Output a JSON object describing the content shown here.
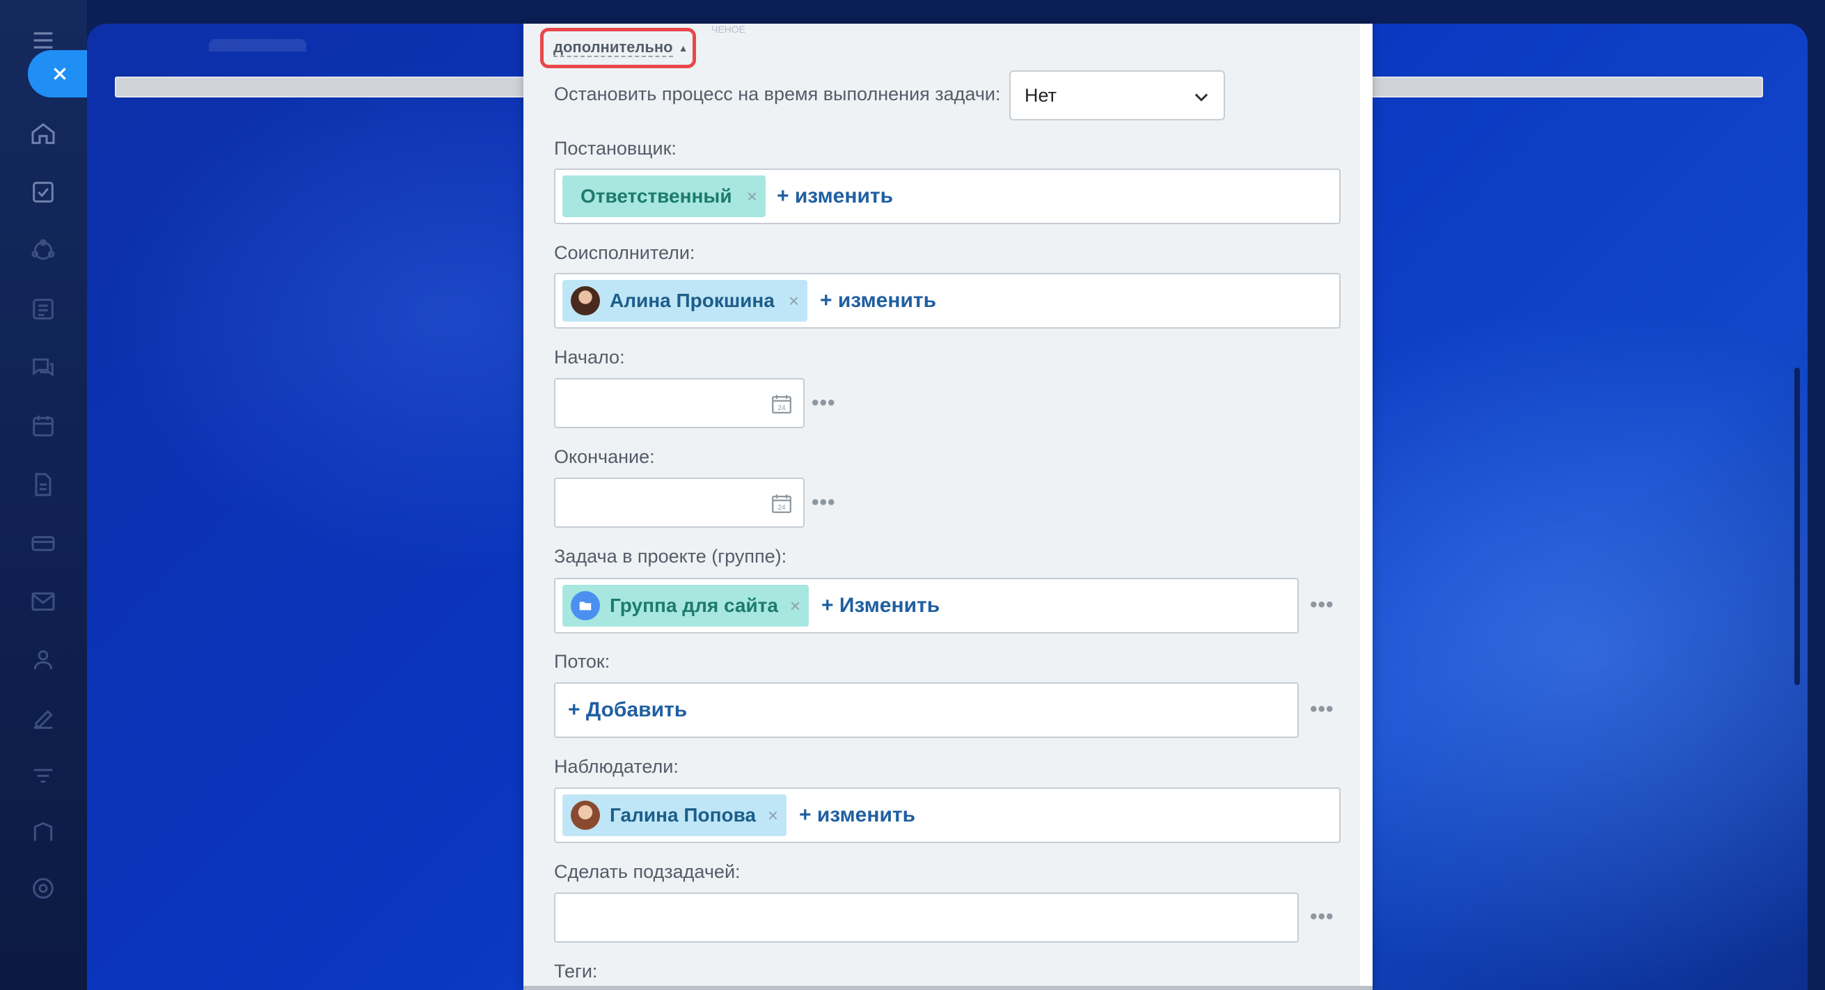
{
  "panel": {
    "more_link": "дополнительно",
    "more_arrow": "▲",
    "faint_text": "ЧЕНОЕ",
    "stop_process": {
      "label": "Остановить процесс на время выполнения задачи:",
      "value": "Нет"
    },
    "creator": {
      "label": "Постановщик:",
      "tag": "Ответственный",
      "change": "+ изменить"
    },
    "co_executors": {
      "label": "Соисполнители:",
      "tag": "Алина Прокшина",
      "change": "+ изменить"
    },
    "start": {
      "label": "Начало:",
      "value": ""
    },
    "end": {
      "label": "Окончание:",
      "value": ""
    },
    "project": {
      "label": "Задача в проекте (группе):",
      "tag": "Группа для сайта",
      "change": "+ Изменить"
    },
    "flow": {
      "label": "Поток:",
      "add": "+ Добавить"
    },
    "observers": {
      "label": "Наблюдатели:",
      "tag": "Галина Попова",
      "change": "+ изменить"
    },
    "subtask": {
      "label": "Сделать подзадачей:",
      "value": ""
    },
    "tags": {
      "label": "Теги:"
    },
    "remove_symbol": "×",
    "more_dots": "•••",
    "calendar_day": "24"
  },
  "icons": {
    "rail": [
      "menu-icon",
      "close-icon",
      "home-icon",
      "tasks-icon",
      "crm-icon",
      "feed-icon",
      "chat-icon",
      "calendar-icon",
      "docs-icon",
      "store-icon",
      "mail-icon",
      "contacts-icon",
      "sign-icon",
      "filter-icon",
      "automation-icon",
      "settings-icon"
    ]
  },
  "colors": {
    "accent_blue": "#1f8ff5",
    "highlight_red": "#e8474a",
    "tag_green": "#a7e7df",
    "tag_blue": "#bfe6f6",
    "link_blue": "#1f5fa0"
  }
}
